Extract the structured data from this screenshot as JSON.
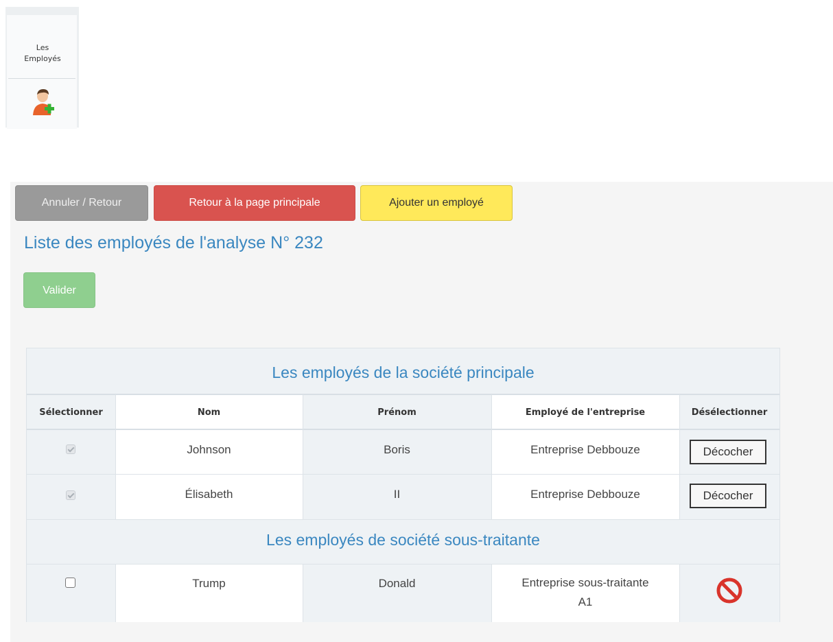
{
  "tile": {
    "label_line1": "Les",
    "label_line2": "Employés",
    "icon": "add-user-icon"
  },
  "toolbar": {
    "cancel_label": "Annuler / Retour",
    "home_label": "Retour à la page principale",
    "add_label": "Ajouter un employé"
  },
  "page_title": "Liste des employés de l'analyse N° 232",
  "validate_label": "Valider",
  "table": {
    "section_main_title": "Les employés de la société principale",
    "section_sub_title": "Les employés de société sous-traitante",
    "columns": [
      "Sélectionner",
      "Nom",
      "Prénom",
      "Employé de l'entreprise",
      "Désélectionner"
    ],
    "main_rows": [
      {
        "selected": true,
        "disabled": true,
        "nom": "Johnson",
        "prenom": "Boris",
        "entreprise": "Entreprise Debbouze",
        "action": "Décocher"
      },
      {
        "selected": true,
        "disabled": true,
        "nom": "Élisabeth",
        "prenom": "II",
        "entreprise": "Entreprise Debbouze",
        "action": "Décocher"
      }
    ],
    "sub_rows": [
      {
        "selected": false,
        "nom": "Trump",
        "prenom": "Donald",
        "entreprise_line1": "Entreprise sous-traitante",
        "entreprise_line2": "A1",
        "action_icon": "forbidden-icon"
      }
    ]
  },
  "colors": {
    "accent_blue": "#3a87c0",
    "btn_grey": "#9a9a9a",
    "btn_red": "#d9534f",
    "btn_yellow": "#ffe95a",
    "btn_green": "#8fcf8f",
    "forbidden_red": "#d9342b"
  }
}
